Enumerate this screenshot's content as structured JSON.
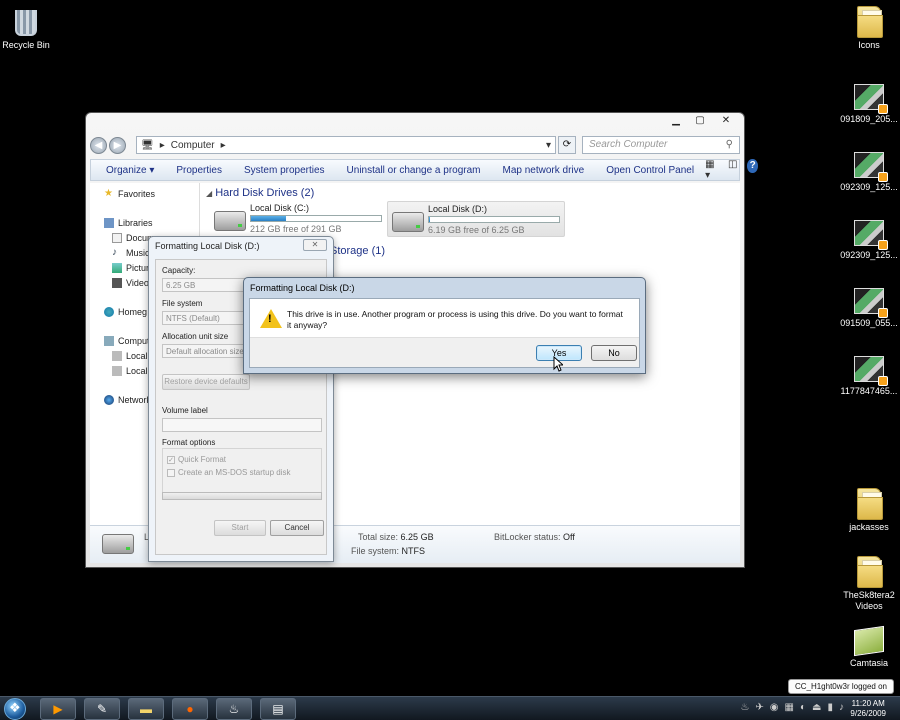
{
  "desktop": {
    "icons_left": [
      {
        "label": "Recycle Bin"
      }
    ],
    "icons_right": [
      {
        "label": "Icons"
      },
      {
        "label": "091809_205..."
      },
      {
        "label": "092309_125..."
      },
      {
        "label": "092309_125..."
      },
      {
        "label": "091509_055..."
      },
      {
        "label": "1177847465..."
      },
      {
        "label": "jackasses"
      },
      {
        "label": "TheSk8tera2 Videos"
      },
      {
        "label": "Camtasia"
      }
    ]
  },
  "explorer": {
    "address": {
      "segments": [
        "Computer"
      ],
      "search_placeholder": "Search Computer"
    },
    "toolbar": [
      "Organize ▾",
      "Properties",
      "System properties",
      "Uninstall or change a program",
      "Map network drive",
      "Open Control Panel"
    ],
    "nav": [
      {
        "label": "Favorites",
        "icon": "star-icon"
      },
      {
        "label": "Libraries",
        "icon": "library-icon"
      },
      {
        "label": "Docum",
        "icon": "documents-icon"
      },
      {
        "label": "Music",
        "icon": "music-icon"
      },
      {
        "label": "Pictur",
        "icon": "pictures-icon"
      },
      {
        "label": "Videos",
        "icon": "videos-icon"
      },
      {
        "label": "Homeg",
        "icon": "homegroup-icon"
      },
      {
        "label": "Comput",
        "icon": "computer-icon"
      },
      {
        "label": "Local",
        "icon": "drive-icon"
      },
      {
        "label": "Local",
        "icon": "drive-icon"
      },
      {
        "label": "Network",
        "icon": "network-icon"
      }
    ],
    "groups": {
      "hard_disks": "Hard Disk Drives (2)",
      "removable": "Storage (1)"
    },
    "drives": [
      {
        "name": "Local Disk (C:)",
        "free_text": "212 GB free of 291 GB",
        "used_fraction": 0.27
      },
      {
        "name": "Local Disk (D:)",
        "free_text": "6.19 GB free of 6.25 GB",
        "used_fraction": 0.01
      }
    ],
    "details": {
      "name": "L",
      "total_size_label": "Total size:",
      "total_size": "6.25 GB",
      "file_system_label": "File system:",
      "file_system": "NTFS",
      "bitlocker_label": "BitLocker status:",
      "bitlocker": "Off"
    }
  },
  "format_dialog": {
    "title": "Formatting Local Disk (D:)",
    "capacity_label": "Capacity:",
    "capacity_value": "6.25 GB",
    "fs_label": "File system",
    "fs_value": "NTFS (Default)",
    "alloc_label": "Allocation unit size",
    "alloc_value": "Default allocation size",
    "restore_label": "Restore device defaults",
    "volume_label": "Volume label",
    "volume_value": "",
    "options_label": "Format options",
    "quick_format": "Quick Format",
    "msdos": "Create an MS-DOS startup disk",
    "start_label": "Start",
    "cancel_label": "Cancel"
  },
  "warning_dialog": {
    "title": "Formatting Local Disk (D:)",
    "message": "This drive is in use. Another program or process is using this drive. Do you want to format it anyway?",
    "yes_label": "Yes",
    "no_label": "No"
  },
  "taskbar": {
    "clock_time": "11:20 AM",
    "clock_date": "9/26/2009",
    "notification": "CC_H1ght0w3r logged on"
  }
}
